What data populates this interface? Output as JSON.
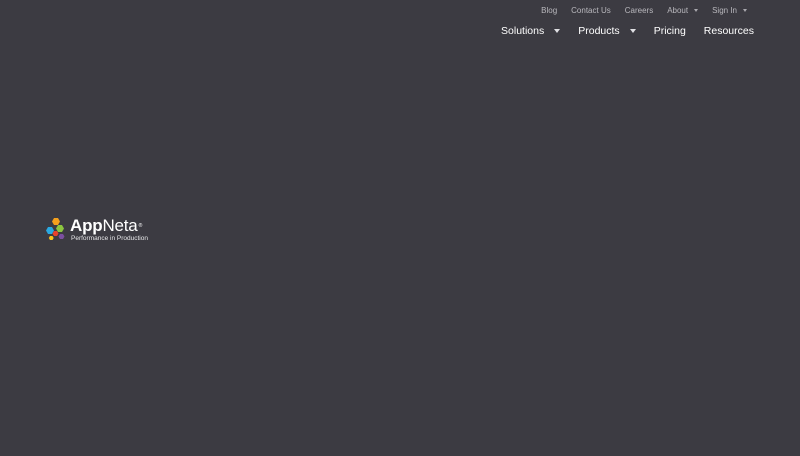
{
  "utility_nav": {
    "blog": "Blog",
    "contact": "Contact Us",
    "careers": "Careers",
    "about": "About",
    "signin": "Sign In"
  },
  "main_nav": {
    "solutions": "Solutions",
    "products": "Products",
    "pricing": "Pricing",
    "resources": "Resources"
  },
  "logo": {
    "app": "App",
    "neta": "Neta",
    "tm": "®",
    "tagline": "Performance in Production"
  },
  "colors": {
    "background": "#3c3b42",
    "logo_dot_orange": "#f5a11d",
    "logo_dot_green": "#8cc63f",
    "logo_dot_blue": "#2aa8e0",
    "logo_dot_red": "#e8412c",
    "logo_dot_purple": "#7b4fa0"
  }
}
